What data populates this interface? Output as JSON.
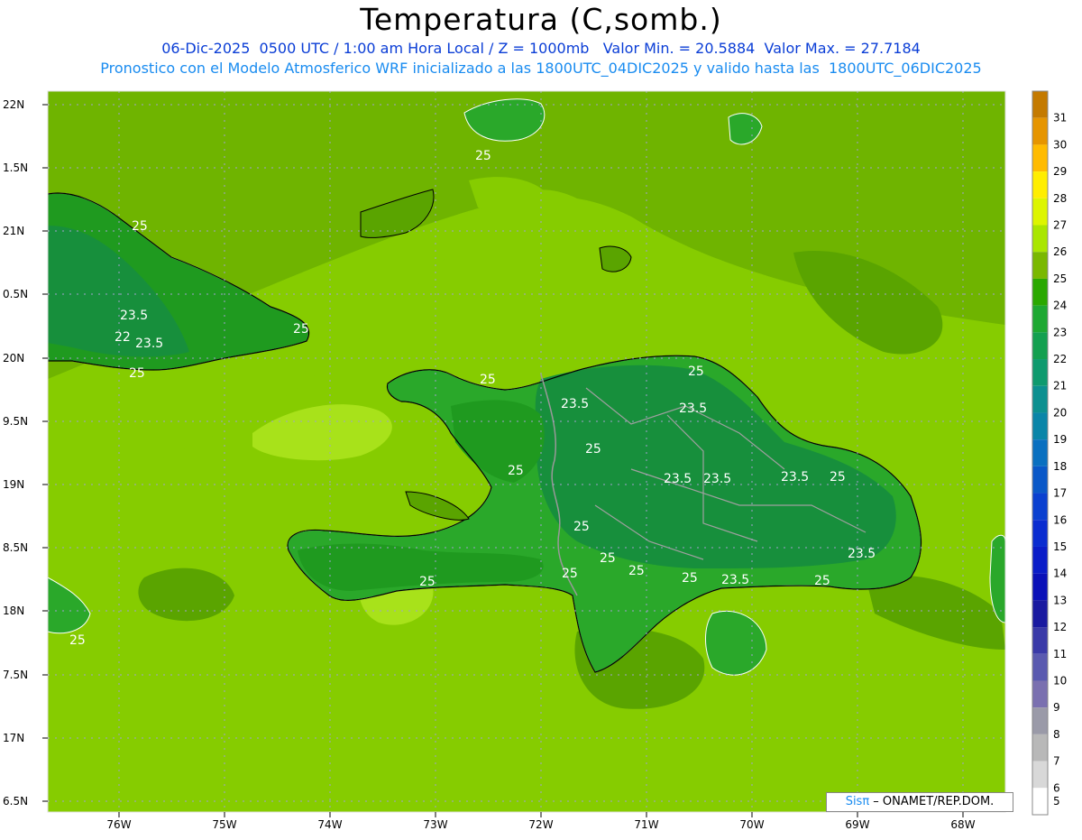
{
  "header": {
    "title": "Temperatura (C,somb.)",
    "line1": "06-Dic-2025  0500 UTC / 1:00 am Hora Local / Z = 1000mb   Valor Min. = 20.5884  Valor Max. = 27.7184",
    "line2": "Pronostico con el Modelo Atmosferico WRF inicializado a las 1800UTC_04DIC2025 y valido hasta las  1800UTC_06DIC2025"
  },
  "axes": {
    "lon_ticks": [
      "76W",
      "75W",
      "74W",
      "73W",
      "72W",
      "71W",
      "70W",
      "69W",
      "68W"
    ],
    "lat_ticks": [
      "22N",
      "1.5N",
      "21N",
      "0.5N",
      "20N",
      "9.5N",
      "19N",
      "8.5N",
      "18N",
      "7.5N",
      "17N",
      "6.5N"
    ]
  },
  "colorbar": {
    "levels": [
      "31",
      "30",
      "29",
      "28",
      "27",
      "26",
      "25",
      "24",
      "23",
      "22",
      "21",
      "20",
      "19",
      "18",
      "17",
      "16",
      "15",
      "14",
      "13",
      "12",
      "11",
      "10",
      "9",
      "8",
      "7",
      "6",
      "5"
    ],
    "colors": [
      "#c47a00",
      "#e69500",
      "#ffbb00",
      "#ffee00",
      "#ddf500",
      "#aae600",
      "#7ab800",
      "#2aa800",
      "#1ea832",
      "#14a050",
      "#0e9a6e",
      "#0c9090",
      "#0a85a8",
      "#0a70c0",
      "#0a58c8",
      "#0a40d0",
      "#0a2cd0",
      "#0a1cc8",
      "#0a10b8",
      "#1a1aa0",
      "#3a3aa8",
      "#5a5ab0",
      "#7a70b0",
      "#9a9aa8",
      "#b8b8b8",
      "#d8d8d8",
      "#ffffff"
    ]
  },
  "map_colors": {
    "sea_main": "#6fb400",
    "sea_light": "#86cc00",
    "sea_pale": "#a8e21a",
    "land_dark": "#1f9a1f",
    "land_mid": "#2aa82a",
    "land_deep": "#178f3c"
  },
  "contour_labels": [
    "25",
    "25",
    "25",
    "23.5",
    "23.5",
    "22",
    "25",
    "25",
    "23.5",
    "25",
    "23.5",
    "25",
    "23.5",
    "23.5",
    "23.5",
    "25",
    "25",
    "25",
    "25",
    "25",
    "25",
    "25",
    "23.5",
    "23.5",
    "25",
    "25",
    "25"
  ],
  "credit": {
    "sis": "Sisπ",
    "rest": " – ONAMET/REP.DOM."
  }
}
